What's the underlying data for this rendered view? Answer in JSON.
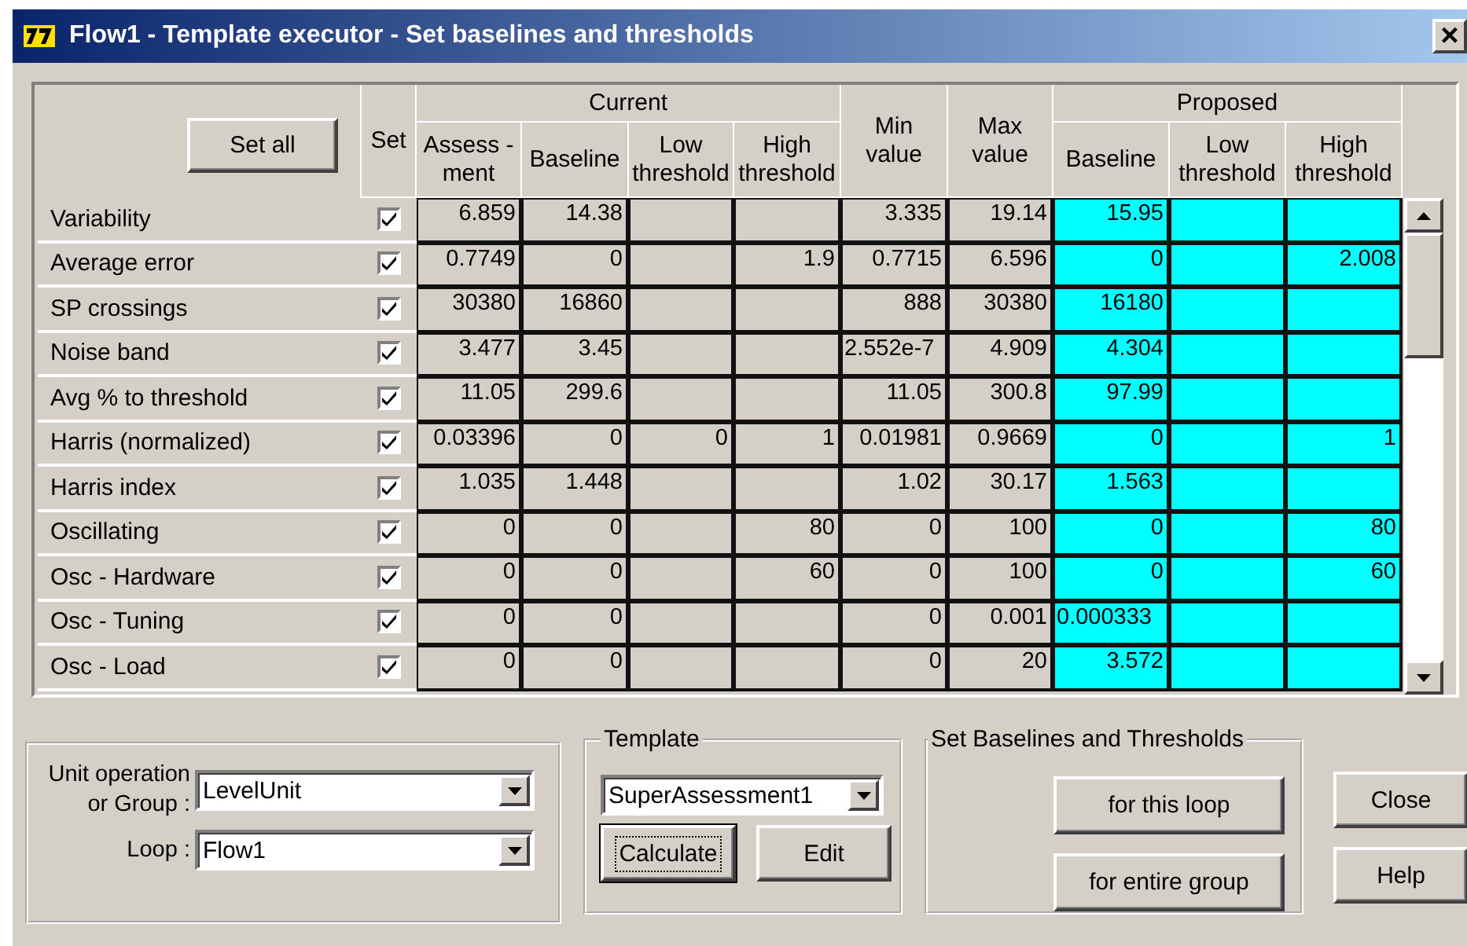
{
  "window": {
    "title": "Flow1 - Template executor - Set baselines and thresholds",
    "close_button": "×"
  },
  "grid": {
    "set_all_button": "Set all",
    "set_header": "Set",
    "header": [
      {
        "kind": "group",
        "label": "Current",
        "columns": [
          "Assess -ment",
          "Baseline",
          "Low threshold",
          "High threshold"
        ]
      },
      {
        "kind": "column",
        "label": "Min value"
      },
      {
        "kind": "column",
        "label": "Max value"
      },
      {
        "kind": "proposed_group",
        "label": "Proposed",
        "columns": [
          "Baseline",
          "Low threshold",
          "High threshold"
        ]
      }
    ],
    "rows": [
      {
        "name": "Variability",
        "set": true,
        "assessment": "6.859",
        "baseline": "14.38",
        "min_value": "3.335",
        "max_value": "19.14",
        "proposed_baseline": "15.95"
      },
      {
        "name": "Average error",
        "set": true,
        "assessment": "0.7749",
        "baseline": "0",
        "high_threshold": "1.9",
        "min_value": "0.7715",
        "max_value": "6.596",
        "proposed_baseline": "0",
        "proposed_high_threshold": "2.008"
      },
      {
        "name": "SP crossings",
        "set": true,
        "assessment": "30380",
        "baseline": "16860",
        "min_value": "888",
        "max_value": "30380",
        "proposed_baseline": "16180"
      },
      {
        "name": "Noise band",
        "set": true,
        "assessment": "3.477",
        "baseline": "3.45",
        "min_value": "2.552e-7",
        "max_value": "4.909",
        "proposed_baseline": "4.304"
      },
      {
        "name": "Avg % to threshold",
        "set": true,
        "assessment": "11.05",
        "baseline": "299.6",
        "min_value": "11.05",
        "max_value": "300.8",
        "proposed_baseline": "97.99"
      },
      {
        "name": "Harris (normalized)",
        "set": true,
        "assessment": "0.03396",
        "baseline": "0",
        "low_threshold": "0",
        "high_threshold": "1",
        "min_value": "0.01981",
        "max_value": "0.9669",
        "proposed_baseline": "0",
        "proposed_high_threshold": "1"
      },
      {
        "name": "Harris index",
        "set": true,
        "assessment": "1.035",
        "baseline": "1.448",
        "min_value": "1.02",
        "max_value": "30.17",
        "proposed_baseline": "1.563"
      },
      {
        "name": "Oscillating",
        "set": true,
        "assessment": "0",
        "baseline": "0",
        "high_threshold": "80",
        "min_value": "0",
        "max_value": "100",
        "proposed_baseline": "0",
        "proposed_high_threshold": "80"
      },
      {
        "name": "Osc - Hardware",
        "set": true,
        "assessment": "0",
        "baseline": "0",
        "high_threshold": "60",
        "min_value": "0",
        "max_value": "100",
        "proposed_baseline": "0",
        "proposed_high_threshold": "60"
      },
      {
        "name": "Osc - Tuning",
        "set": true,
        "assessment": "0",
        "baseline": "0",
        "min_value": "0",
        "max_value": "0.001",
        "proposed_baseline": "0.000333"
      },
      {
        "name": "Osc - Load",
        "set": true,
        "assessment": "0",
        "baseline": "0",
        "min_value": "0",
        "max_value": "20",
        "proposed_baseline": "3.572"
      }
    ]
  },
  "unit_group": {
    "unit_label": "Unit operation or Group :",
    "unit_value": "LevelUnit",
    "loop_label": "Loop :",
    "loop_value": "Flow1"
  },
  "template": {
    "legend": "Template",
    "value": "SuperAssessment1",
    "buttons": [
      {
        "label": "Calculate",
        "focused": true
      },
      {
        "label": "Edit",
        "focused": false
      }
    ]
  },
  "set_baselines": {
    "legend": "Set Baselines and Thresholds",
    "buttons": [
      "for this loop",
      "for entire group"
    ]
  },
  "dialog_buttons": [
    "Close",
    "Help"
  ]
}
